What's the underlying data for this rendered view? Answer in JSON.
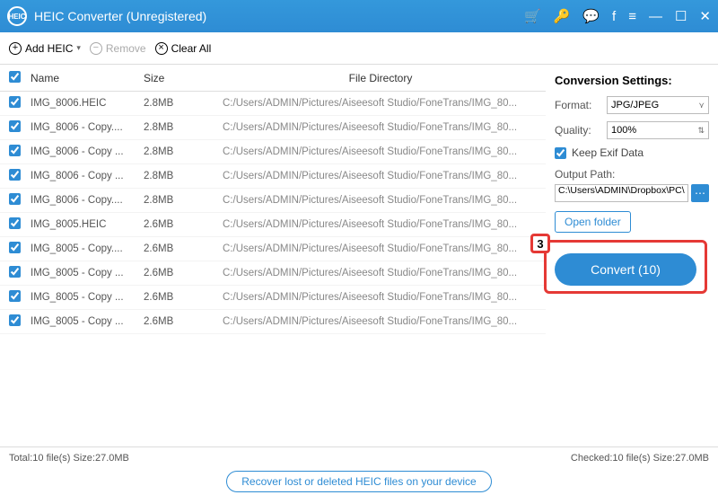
{
  "title": "HEIC Converter (Unregistered)",
  "toolbar": {
    "add": "Add HEIC",
    "remove": "Remove",
    "clear": "Clear All"
  },
  "headers": {
    "name": "Name",
    "size": "Size",
    "dir": "File Directory"
  },
  "files": [
    {
      "name": "IMG_8006.HEIC",
      "size": "2.8MB",
      "dir": "C:/Users/ADMIN/Pictures/Aiseesoft Studio/FoneTrans/IMG_80..."
    },
    {
      "name": "IMG_8006 - Copy....",
      "size": "2.8MB",
      "dir": "C:/Users/ADMIN/Pictures/Aiseesoft Studio/FoneTrans/IMG_80..."
    },
    {
      "name": "IMG_8006 - Copy ...",
      "size": "2.8MB",
      "dir": "C:/Users/ADMIN/Pictures/Aiseesoft Studio/FoneTrans/IMG_80..."
    },
    {
      "name": "IMG_8006 - Copy ...",
      "size": "2.8MB",
      "dir": "C:/Users/ADMIN/Pictures/Aiseesoft Studio/FoneTrans/IMG_80..."
    },
    {
      "name": "IMG_8006 - Copy....",
      "size": "2.8MB",
      "dir": "C:/Users/ADMIN/Pictures/Aiseesoft Studio/FoneTrans/IMG_80..."
    },
    {
      "name": "IMG_8005.HEIC",
      "size": "2.6MB",
      "dir": "C:/Users/ADMIN/Pictures/Aiseesoft Studio/FoneTrans/IMG_80..."
    },
    {
      "name": "IMG_8005 - Copy....",
      "size": "2.6MB",
      "dir": "C:/Users/ADMIN/Pictures/Aiseesoft Studio/FoneTrans/IMG_80..."
    },
    {
      "name": "IMG_8005 - Copy ...",
      "size": "2.6MB",
      "dir": "C:/Users/ADMIN/Pictures/Aiseesoft Studio/FoneTrans/IMG_80..."
    },
    {
      "name": "IMG_8005 - Copy ...",
      "size": "2.6MB",
      "dir": "C:/Users/ADMIN/Pictures/Aiseesoft Studio/FoneTrans/IMG_80..."
    },
    {
      "name": "IMG_8005 - Copy ...",
      "size": "2.6MB",
      "dir": "C:/Users/ADMIN/Pictures/Aiseesoft Studio/FoneTrans/IMG_80..."
    }
  ],
  "settings": {
    "title": "Conversion Settings:",
    "format_label": "Format:",
    "format": "JPG/JPEG",
    "quality_label": "Quality:",
    "quality": "100%",
    "keep": "Keep Exif Data",
    "path_label": "Output Path:",
    "path": "C:\\Users\\ADMIN\\Dropbox\\PC\\",
    "open": "Open folder"
  },
  "annot": "3",
  "convert": "Convert (10)",
  "status": {
    "total": "Total:10 file(s) Size:27.0MB",
    "checked": "Checked:10 file(s) Size:27.0MB"
  },
  "footer": "Recover lost or deleted HEIC files on your device"
}
